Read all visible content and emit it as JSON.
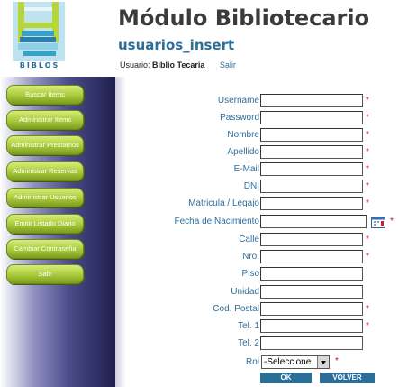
{
  "header": {
    "logo_text": "BIBLOS",
    "title": "Módulo Bibliotecario",
    "subtitle": "usuarios_insert",
    "user_label": "Usuario:",
    "user_name": "Biblio Tecaria",
    "logout_link": "Salir"
  },
  "sidebar": {
    "items": [
      {
        "label": "Buscar Items"
      },
      {
        "label": "Administrar Items"
      },
      {
        "label": "Administrar Prestamos"
      },
      {
        "label": "Administrar Reservas"
      },
      {
        "label": "Administrar Usuarios"
      },
      {
        "label": "Emitir Listado Diario"
      },
      {
        "label": "Cambiar Contraseña"
      },
      {
        "label": "Salir"
      }
    ]
  },
  "form": {
    "fields": [
      {
        "label": "Username",
        "value": "",
        "required": "*"
      },
      {
        "label": "Password",
        "value": "",
        "required": "*"
      },
      {
        "label": "Nombre",
        "value": "",
        "required": "*"
      },
      {
        "label": "Apellido",
        "value": "",
        "required": "*"
      },
      {
        "label": "E-Mail",
        "value": "",
        "required": "*"
      },
      {
        "label": "DNI",
        "value": "",
        "required": "*"
      },
      {
        "label": "Matricula / Legajo",
        "value": "",
        "required": "*"
      },
      {
        "label": "Fecha de Nacimiento",
        "value": "",
        "required": "*"
      },
      {
        "label": "Calle",
        "value": "",
        "required": "*"
      },
      {
        "label": "Nro.",
        "value": "",
        "required": "*"
      },
      {
        "label": "Piso",
        "value": "",
        "required": ""
      },
      {
        "label": "Unidad",
        "value": "",
        "required": ""
      },
      {
        "label": "Cod. Postal",
        "value": "",
        "required": "*"
      },
      {
        "label": "Tel. 1",
        "value": "",
        "required": "*"
      },
      {
        "label": "Tel. 2",
        "value": "",
        "required": ""
      }
    ],
    "rol": {
      "label": "Rol",
      "selected": "-Seleccione",
      "required": "*"
    },
    "ok_label": "OK",
    "back_label": "VOLVER"
  },
  "colors": {
    "accent": "#2b6f98",
    "required": "#d01010",
    "nav_green": "#a8c93a"
  }
}
